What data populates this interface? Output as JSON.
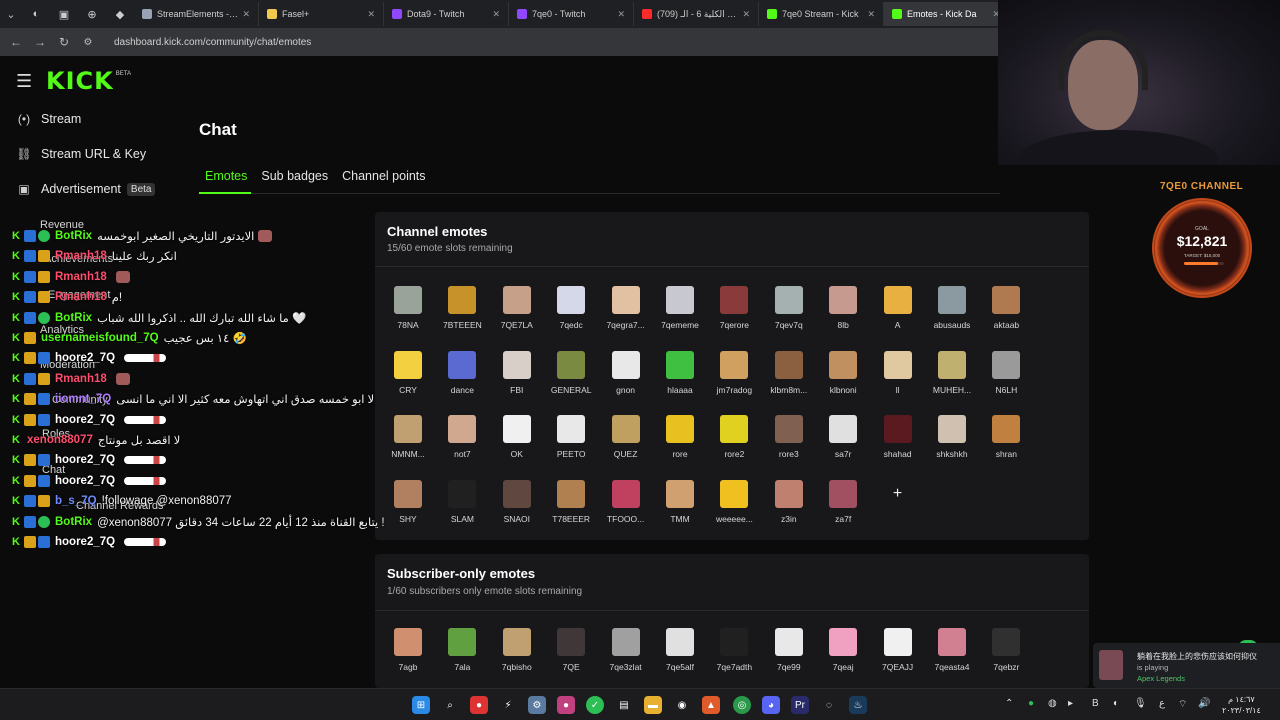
{
  "browser": {
    "tabs": [
      {
        "title": "StreamElements - 7qe0",
        "color": "#9aa3b5",
        "active": false
      },
      {
        "title": "Fasel+",
        "color": "#f2c94c",
        "active": false
      },
      {
        "title": "Dota9 - Twitch",
        "color": "#9146ff",
        "active": false
      },
      {
        "title": "7qe0 - Twitch",
        "color": "#9146ff",
        "active": false
      },
      {
        "title": "(709) تحدي الكلية 6 - الـ",
        "color": "#ff2a2a",
        "active": false
      },
      {
        "title": "7qe0 Stream - Kick",
        "color": "#53fc18",
        "active": false
      },
      {
        "title": "Emotes - Kick Da",
        "color": "#53fc18",
        "active": true
      }
    ],
    "url": "dashboard.kick.com/community/chat/emotes"
  },
  "header": {
    "logo": "KICK",
    "beta": "BETA"
  },
  "sidebar": {
    "items": [
      {
        "label": "Stream",
        "icon": "broadcast-icon",
        "glyph": "(•)"
      },
      {
        "label": "Stream URL & Key",
        "icon": "link-icon",
        "glyph": "⛓"
      },
      {
        "label": "Advertisement",
        "icon": "ad-icon",
        "glyph": "▣",
        "badge": "Beta"
      }
    ],
    "faint": [
      "Revenue",
      "Achievements",
      "Engagement",
      "Analytics",
      "Moderation",
      "Community",
      "Roles",
      "Chat",
      "Channel Rewards"
    ]
  },
  "chat": [
    {
      "user": "BotRix",
      "color": "#53fc18",
      "badges": [
        "kick",
        "blue",
        "green"
      ],
      "msg": "الايدتور التاريخي الصغير ابوخمسه",
      "emote": "sm"
    },
    {
      "user": "Rmanh18",
      "color": "#ff4d6d",
      "badges": [
        "kick",
        "blue",
        "gold"
      ],
      "msg": "انكر ربك علينا",
      "emote": ""
    },
    {
      "user": "Rmanh18",
      "color": "#ff4d6d",
      "badges": [
        "kick",
        "blue",
        "gold"
      ],
      "msg": "",
      "emote": "sm"
    },
    {
      "user": "Rmanh18",
      "color": "#ff4d6d",
      "badges": [
        "kick",
        "blue",
        "gold"
      ],
      "msg": "م!",
      "emote": ""
    },
    {
      "user": "BotRix",
      "color": "#53fc18",
      "badges": [
        "kick",
        "blue",
        "green"
      ],
      "msg": "ما شاء الله تبارك الله .. اذكروا الله شباب 🤍",
      "emote": ""
    },
    {
      "user": "usernameisfound_7Q",
      "color": "#53fc18",
      "badges": [
        "kick",
        "gold"
      ],
      "msg": "١٤ بس عجيب 🤣",
      "emote": ""
    },
    {
      "user": "hoore2_7Q",
      "color": "#ffffff",
      "badges": [
        "kick",
        "gold",
        "blue"
      ],
      "msg": "",
      "emote": "bird"
    },
    {
      "user": "Rmanh18",
      "color": "#ff4d6d",
      "badges": [
        "kick",
        "blue",
        "gold"
      ],
      "msg": "",
      "emote": "sm"
    },
    {
      "user": "iiomnt_7Q",
      "color": "#b07cff",
      "badges": [
        "kick",
        "gold",
        "blue"
      ],
      "msg": "لا ابو خمسه صدق اني اتهاوش معه كثير الا اني ما انسى",
      "emote": ""
    },
    {
      "user": "hoore2_7Q",
      "color": "#ffffff",
      "badges": [
        "kick",
        "gold",
        "blue"
      ],
      "msg": "",
      "emote": "bird"
    },
    {
      "user": "xenon88077",
      "color": "#ff4d6d",
      "badges": [
        "kick"
      ],
      "msg": "لا اقصد بل مونتاج",
      "emote": ""
    },
    {
      "user": "hoore2_7Q",
      "color": "#ffffff",
      "badges": [
        "kick",
        "gold",
        "blue"
      ],
      "msg": "",
      "emote": "bird"
    },
    {
      "user": "hoore2_7Q",
      "color": "#ffffff",
      "badges": [
        "kick",
        "gold",
        "blue"
      ],
      "msg": "",
      "emote": "bird"
    },
    {
      "user": "b_s_7Q",
      "color": "#6f8cff",
      "badges": [
        "kick",
        "blue",
        "gold"
      ],
      "msg": "!followage @xenon88077",
      "emote": ""
    },
    {
      "user": "BotRix",
      "color": "#53fc18",
      "badges": [
        "kick",
        "blue",
        "green"
      ],
      "msg": "@xenon88077 يتابع القناة منذ 12 أيام 22 ساعات 34 دقائق !",
      "emote": ""
    },
    {
      "user": "hoore2_7Q",
      "color": "#ffffff",
      "badges": [
        "kick",
        "gold",
        "blue"
      ],
      "msg": "",
      "emote": "bird"
    }
  ],
  "page": {
    "title": "Chat",
    "tabs": [
      "Emotes",
      "Sub badges",
      "Channel points"
    ],
    "active_tab": 0
  },
  "channel_emotes": {
    "title": "Channel emotes",
    "subtitle": "15/60 emote slots remaining",
    "items": [
      {
        "name": "78NA",
        "color": "#9aa39a"
      },
      {
        "name": "7BTEEEN",
        "color": "#c8922a"
      },
      {
        "name": "7QE7LA",
        "color": "#c7a08a"
      },
      {
        "name": "7qedc",
        "color": "#d5d8e8"
      },
      {
        "name": "7qegra7...",
        "color": "#e2c0a2"
      },
      {
        "name": "7qememe",
        "color": "#c8c8d0"
      },
      {
        "name": "7qerore",
        "color": "#8a3a3a"
      },
      {
        "name": "7qev7q",
        "color": "#a5b0b0"
      },
      {
        "name": "8lb",
        "color": "#c79a90"
      },
      {
        "name": "A",
        "color": "#e8b040"
      },
      {
        "name": "abusauds",
        "color": "#8a9aa0"
      },
      {
        "name": "aktaab",
        "color": "#b07a50"
      },
      {
        "name": "CRY",
        "color": "#f2d040"
      },
      {
        "name": "dance",
        "color": "#5a6ad0"
      },
      {
        "name": "FBI",
        "color": "#d8d0c8"
      },
      {
        "name": "GENERAL",
        "color": "#7a8a40"
      },
      {
        "name": "gnon",
        "color": "#e8e8e8"
      },
      {
        "name": "hlaaaa",
        "color": "#40c040"
      },
      {
        "name": "jm7radog",
        "color": "#d0a060"
      },
      {
        "name": "klbm8m...",
        "color": "#8a6040"
      },
      {
        "name": "klbnoni",
        "color": "#c09060"
      },
      {
        "name": "ll",
        "color": "#e0c8a0"
      },
      {
        "name": "MUHEH...",
        "color": "#c0b070"
      },
      {
        "name": "N6LH",
        "color": "#9a9a9a"
      },
      {
        "name": "NMNM...",
        "color": "#c0a070"
      },
      {
        "name": "not7",
        "color": "#d0a890"
      },
      {
        "name": "OK",
        "color": "#f0f0f0"
      },
      {
        "name": "PEETO",
        "color": "#e8e8e8"
      },
      {
        "name": "QUEZ",
        "color": "#c0a060"
      },
      {
        "name": "rore",
        "color": "#e8c020"
      },
      {
        "name": "rore2",
        "color": "#e0d020"
      },
      {
        "name": "rore3",
        "color": "#806050"
      },
      {
        "name": "sa7r",
        "color": "#e0e0e0"
      },
      {
        "name": "shahad",
        "color": "#5a1a20"
      },
      {
        "name": "shkshkh",
        "color": "#d0c0b0"
      },
      {
        "name": "shran",
        "color": "#c08040"
      },
      {
        "name": "SHY",
        "color": "#b08060"
      },
      {
        "name": "SLAM",
        "color": "#202020"
      },
      {
        "name": "SNAOI",
        "color": "#604840"
      },
      {
        "name": "T78EEER",
        "color": "#b08050"
      },
      {
        "name": "TFOOO...",
        "color": "#c04060"
      },
      {
        "name": "TMM",
        "color": "#d0a070"
      },
      {
        "name": "weeeee...",
        "color": "#f0c020"
      },
      {
        "name": "z3in",
        "color": "#c08070"
      },
      {
        "name": "za7f",
        "color": "#a05060"
      }
    ],
    "add_label": "+"
  },
  "subscriber_emotes": {
    "title": "Subscriber-only emotes",
    "subtitle": "1/60 subscribers only emote slots remaining",
    "items": [
      {
        "name": "7agb",
        "color": "#d09070"
      },
      {
        "name": "7ala",
        "color": "#60a040"
      },
      {
        "name": "7qbisho",
        "color": "#c0a070"
      },
      {
        "name": "7QE",
        "color": "#403838"
      },
      {
        "name": "7qe3zlat",
        "color": "#a0a0a0"
      },
      {
        "name": "7qe5alf",
        "color": "#e0e0e0"
      },
      {
        "name": "7qe7adth",
        "color": "#202020"
      },
      {
        "name": "7qe99",
        "color": "#e8e8e8"
      },
      {
        "name": "7qeaj",
        "color": "#f0a0c0"
      },
      {
        "name": "7QEAJJ",
        "color": "#f0f0f0"
      },
      {
        "name": "7qeasta4",
        "color": "#d08090"
      },
      {
        "name": "7qebzr",
        "color": "#303030"
      }
    ]
  },
  "channel_widget": {
    "label": "7QE0 CHANNEL",
    "goal_small": "GOAL",
    "amount": "$12,821",
    "target": "TARGET: $15,000",
    "progress": 0.85,
    "accent": "#e89a3a"
  },
  "notification": {
    "title": "躺着在我脸上的悲伤应该如何抑仪",
    "sub": "is playing",
    "game": "Apex Legends"
  },
  "taskbar": {
    "clock_time": "١٤:٦٧ م",
    "clock_date": "٢٠٢٣/٠٣/١٤"
  }
}
